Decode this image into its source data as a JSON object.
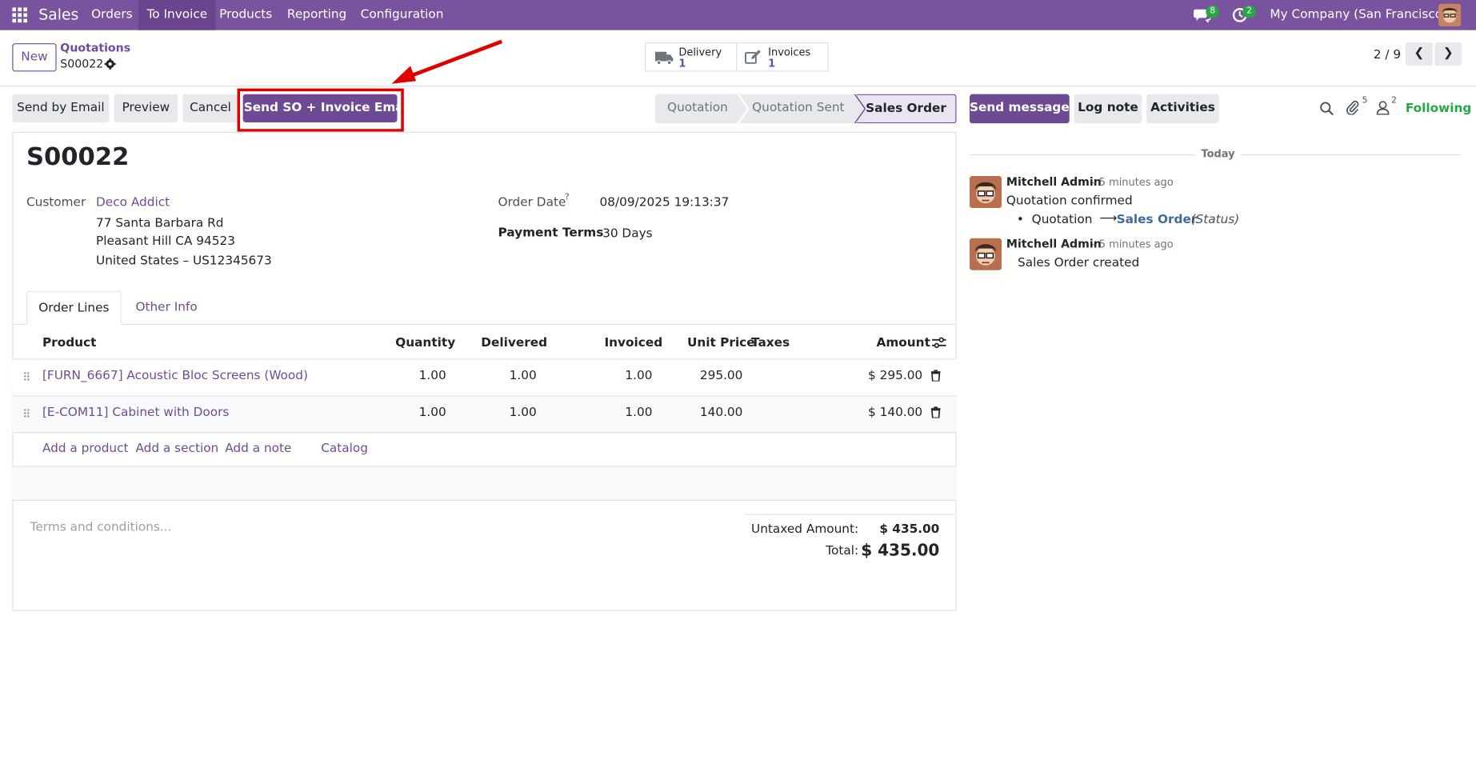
{
  "navbar": {
    "app_name": "Sales",
    "menus": [
      "Orders",
      "To Invoice",
      "Products",
      "Reporting",
      "Configuration"
    ],
    "messages_count": "8",
    "activities_count": "2",
    "company": "My Company (San Francisco)"
  },
  "control_panel": {
    "new_button": "New",
    "breadcrumb_parent": "Quotations",
    "record_name": "S00022",
    "pager": "2 / 9",
    "smart_buttons": {
      "delivery_label": "Delivery",
      "delivery_count": "1",
      "invoices_label": "Invoices",
      "invoices_count": "1"
    }
  },
  "actions": {
    "send_by_email": "Send by Email",
    "preview": "Preview",
    "cancel": "Cancel",
    "send_so_invoice": "Send SO + Invoice Email"
  },
  "status_bar": [
    "Quotation",
    "Quotation Sent",
    "Sales Order"
  ],
  "form": {
    "title": "S00022",
    "customer_label": "Customer",
    "customer_name": "Deco Addict",
    "address_line1": "77 Santa Barbara Rd",
    "address_line2": "Pleasant Hill CA 94523",
    "address_line3": "United States – US12345673",
    "order_date_label": "Order Date",
    "order_date_help": "?",
    "order_date": "08/09/2025 19:13:37",
    "payment_terms_label": "Payment Terms",
    "payment_terms": "30 Days",
    "tabs": [
      "Order Lines",
      "Other Info"
    ],
    "columns": [
      "Product",
      "Quantity",
      "Delivered",
      "Invoiced",
      "Unit Price",
      "Taxes",
      "Amount"
    ],
    "lines": [
      {
        "product": "[FURN_6667] Acoustic Bloc Screens (Wood)",
        "quantity": "1.00",
        "delivered": "1.00",
        "invoiced": "1.00",
        "unit_price": "295.00",
        "taxes": "",
        "amount": "$ 295.00"
      },
      {
        "product": "[E-COM11] Cabinet with Doors",
        "quantity": "1.00",
        "delivered": "1.00",
        "invoiced": "1.00",
        "unit_price": "140.00",
        "taxes": "",
        "amount": "$ 140.00"
      }
    ],
    "add_links": [
      "Add a product",
      "Add a section",
      "Add a note",
      "Catalog"
    ],
    "terms_placeholder": "Terms and conditions...",
    "untaxed_label": "Untaxed Amount:",
    "untaxed_value": "$ 435.00",
    "total_label": "Total:",
    "total_value": "$ 435.00"
  },
  "chatter": {
    "send_message": "Send message",
    "log_note": "Log note",
    "activities": "Activities",
    "attachments_count": "5",
    "followers_count": "2",
    "following": "Following",
    "date_separator": "Today",
    "messages": [
      {
        "author": "Mitchell Admin",
        "time": "- 5 minutes ago",
        "body": "Quotation confirmed",
        "tracking_old": "Quotation",
        "tracking_new": "Sales Order",
        "tracking_field": "(Status)"
      },
      {
        "author": "Mitchell Admin",
        "time": "- 5 minutes ago",
        "body": "Sales Order created"
      }
    ]
  },
  "colors": {
    "brand": "#7a539e",
    "highlight": "#e00000",
    "following": "#28a745"
  }
}
